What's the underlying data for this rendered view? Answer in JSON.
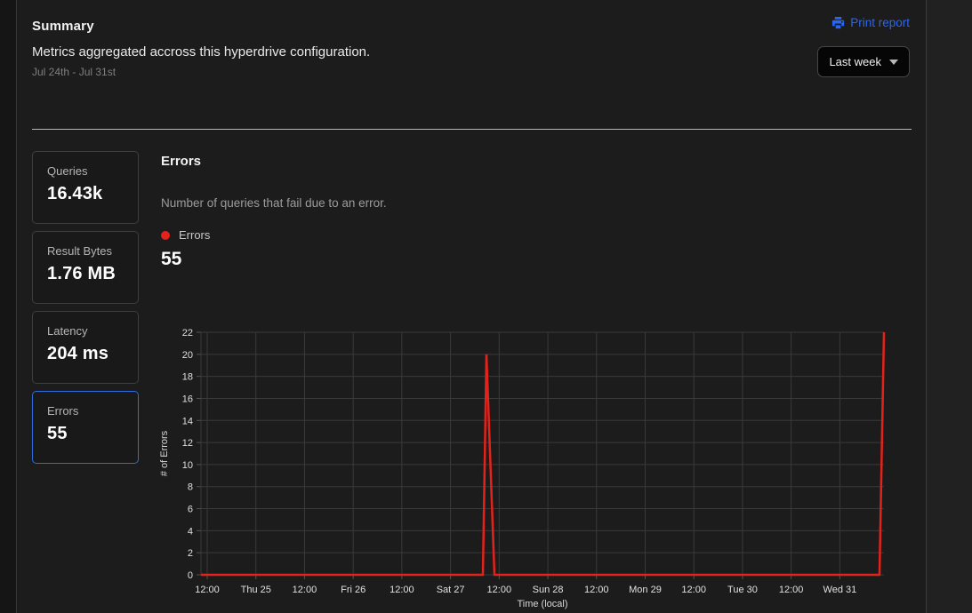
{
  "header": {
    "title": "Summary",
    "description": "Metrics aggregated accross this hyperdrive configuration.",
    "date_range": "Jul 24th - Jul 31st",
    "print_report_label": "Print report",
    "print_report_icon": "printer-icon",
    "range_selector": {
      "value": "Last week",
      "icon": "chevron-down-icon"
    }
  },
  "stats": [
    {
      "label": "Queries",
      "value": "16.43k",
      "selected": false
    },
    {
      "label": "Result Bytes",
      "value": "1.76 MB",
      "selected": false
    },
    {
      "label": "Latency",
      "value": "204 ms",
      "selected": false
    },
    {
      "label": "Errors",
      "value": "55",
      "selected": true
    }
  ],
  "metric_detail": {
    "title": "Errors",
    "description": "Number of queries that fail due to an error.",
    "legend_label": "Errors",
    "legend_color": "#e3231b",
    "value": "55"
  },
  "colors": {
    "accent_blue": "#2767f4",
    "selected_border_blue": "#2f6bdb",
    "series_red": "#e3231b",
    "gridline": "#3a3a3a",
    "tick_text": "#e0e0e0",
    "panel_bg": "#1c1c1c"
  },
  "chart_data": {
    "type": "line",
    "title": "Errors",
    "xlabel": "Time (local)",
    "ylabel": "# of Errors",
    "ylim": [
      0,
      22
    ],
    "yticks": [
      0,
      2,
      4,
      6,
      8,
      10,
      12,
      14,
      16,
      18,
      20,
      22
    ],
    "xticks": [
      "12:00",
      "Thu 25",
      "12:00",
      "Fri 26",
      "12:00",
      "Sat 27",
      "12:00",
      "Sun 28",
      "12:00",
      "Mon 29",
      "12:00",
      "Tue 30",
      "12:00",
      "Wed 31"
    ],
    "xtick_fracs": [
      0.0091,
      0.0804,
      0.1516,
      0.2229,
      0.2941,
      0.3654,
      0.4366,
      0.5079,
      0.5791,
      0.6504,
      0.7216,
      0.7929,
      0.8641,
      0.9354
    ],
    "grid": true,
    "legend_position": "top-left",
    "series": [
      {
        "name": "Errors",
        "color": "#e3231b",
        "points_frac": [
          [
            0.0,
            0
          ],
          [
            0.4128,
            0
          ],
          [
            0.418,
            20
          ],
          [
            0.4297,
            0
          ],
          [
            0.9935,
            0
          ],
          [
            1.0,
            22
          ]
        ],
        "notes": "flat at 0 with a spike to ~20 around Sat 27 ~09:00 and a spike to 22 at the right edge (~Wed 31 11:00)"
      }
    ]
  }
}
